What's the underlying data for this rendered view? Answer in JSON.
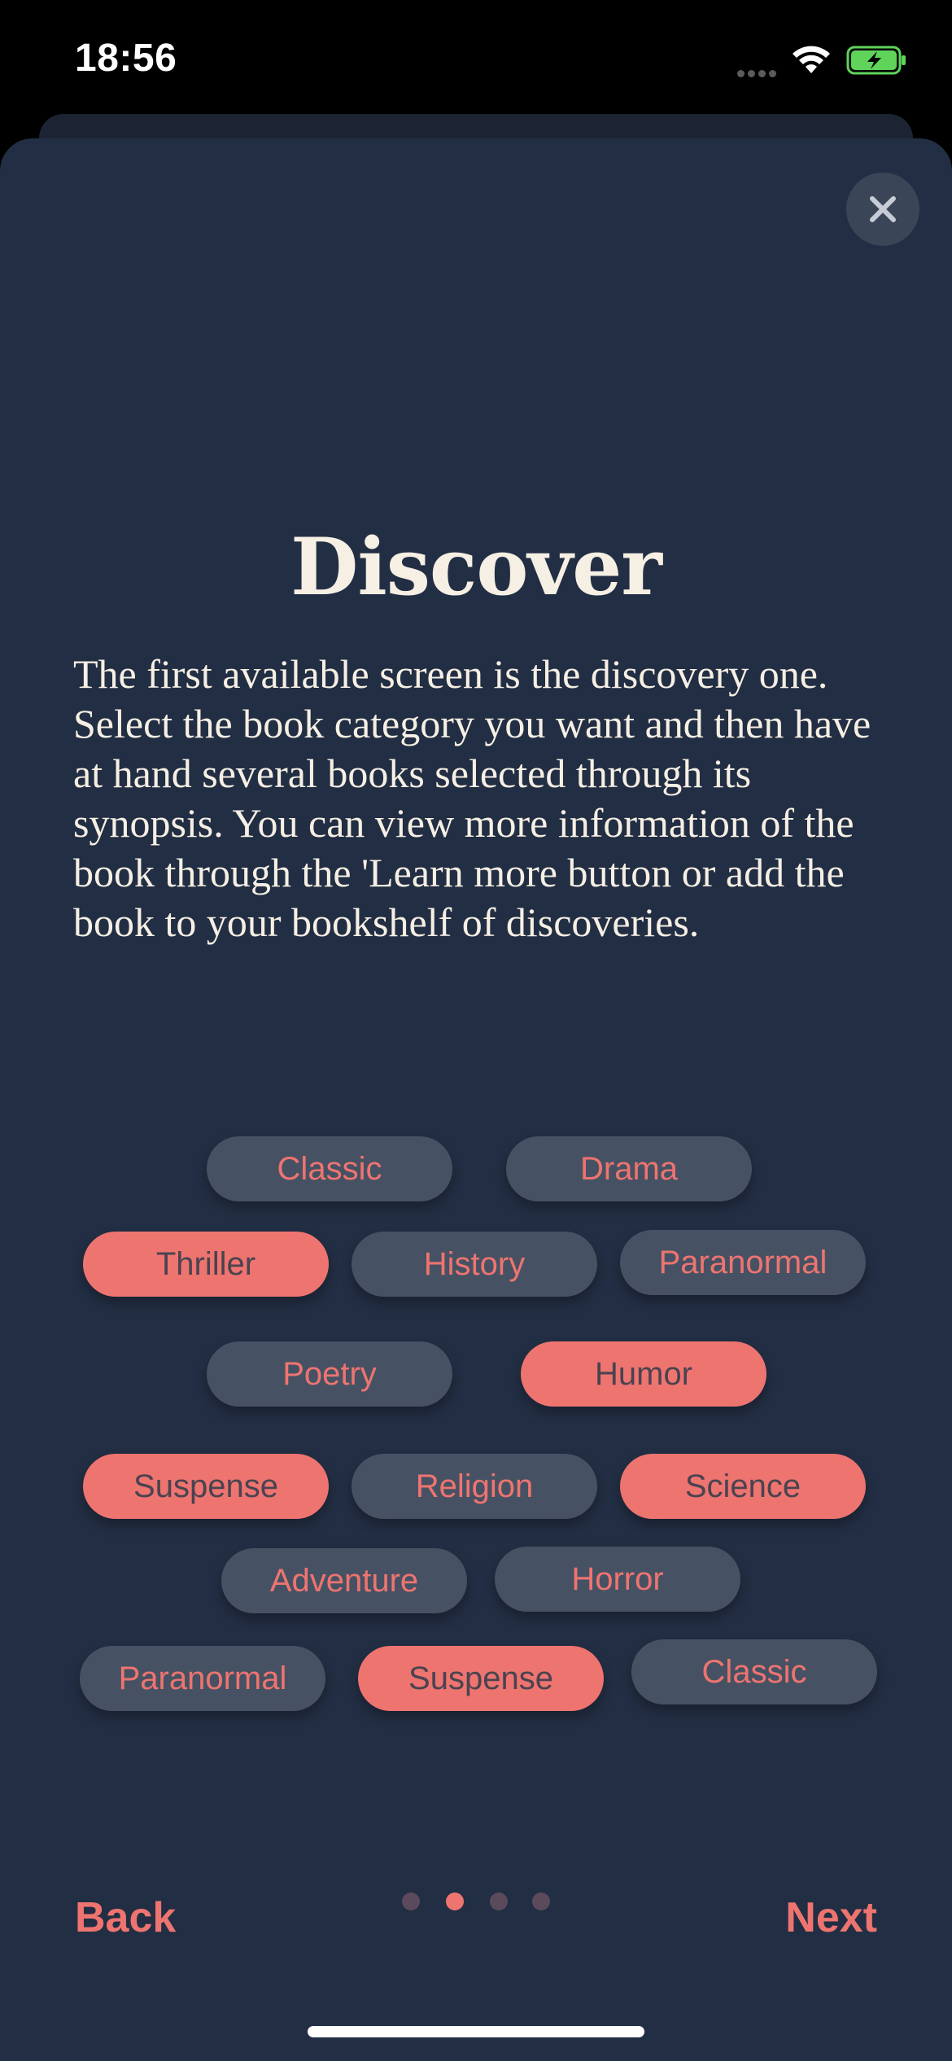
{
  "status_bar": {
    "time": "18:56"
  },
  "sheet": {
    "title": "Discover",
    "description": "The first available screen is the discovery one. Select the book category you want and then have at hand several books selected through its synopsis. You can view more information of the book through the 'Learn more button or add the book to your bookshelf of discoveries.",
    "close_icon": "close-icon"
  },
  "categories": [
    {
      "label": "Classic",
      "selected": false
    },
    {
      "label": "Drama",
      "selected": false
    },
    {
      "label": "Thriller",
      "selected": true
    },
    {
      "label": "History",
      "selected": false
    },
    {
      "label": "Paranormal",
      "selected": false
    },
    {
      "label": "Poetry",
      "selected": false
    },
    {
      "label": "Humor",
      "selected": true
    },
    {
      "label": "Suspense",
      "selected": true
    },
    {
      "label": "Religion",
      "selected": false
    },
    {
      "label": "Science",
      "selected": true
    },
    {
      "label": "Adventure",
      "selected": false
    },
    {
      "label": "Horror",
      "selected": false
    },
    {
      "label": "Paranormal",
      "selected": false
    },
    {
      "label": "Suspense",
      "selected": true
    },
    {
      "label": "Classic",
      "selected": false
    }
  ],
  "footer": {
    "back_label": "Back",
    "next_label": "Next",
    "page_count": 4,
    "active_page": 2
  },
  "colors": {
    "sheet_background": "#222e43",
    "accent": "#ee7470",
    "chip_background": "#465263",
    "title_text": "#f6efe4"
  }
}
